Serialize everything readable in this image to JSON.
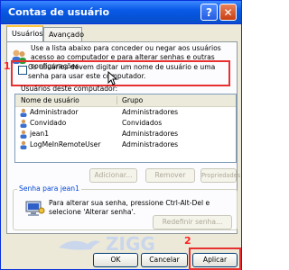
{
  "window": {
    "title": "Contas de usuário"
  },
  "title_buttons": {
    "help": "?",
    "close": "✕"
  },
  "tabs": [
    {
      "label": "Usuários",
      "active": true
    },
    {
      "label": "Avançado",
      "active": false
    }
  ],
  "intro_text": "Use a lista abaixo para conceder ou negar aos usuários acesso ao computador e para alterar senhas e outras configurações.",
  "annotations": {
    "step1": "1",
    "step2": "2"
  },
  "checkbox": {
    "label": "Os usuários devem digitar um nome de usuário e uma senha para usar este computador.",
    "checked": false
  },
  "users": {
    "caption": "Usuários deste computador:",
    "columns": [
      "Nome de usuário",
      "Grupo"
    ],
    "rows": [
      {
        "name": "Administrador",
        "group": "Administradores"
      },
      {
        "name": "Convidado",
        "group": "Convidados"
      },
      {
        "name": "jean1",
        "group": "Administradores"
      },
      {
        "name": "LogMeInRemoteUser",
        "group": "Administradores"
      }
    ]
  },
  "buttons": {
    "add": "Adicionar...",
    "remove": "Remover",
    "properties": "Propriedades",
    "reset_password": "Redefinir senha...",
    "ok": "OK",
    "cancel": "Cancelar",
    "apply": "Aplicar"
  },
  "password_group": {
    "legend": "Senha para jean1",
    "text": "Para alterar sua senha, pressione Ctrl-Alt-Del e selecione 'Alterar senha'."
  },
  "watermark": {
    "text": "ZIGG"
  },
  "colors": {
    "accent": "#0046d5",
    "annotation": "#e83030",
    "titlebar": "#0a5ae8"
  }
}
